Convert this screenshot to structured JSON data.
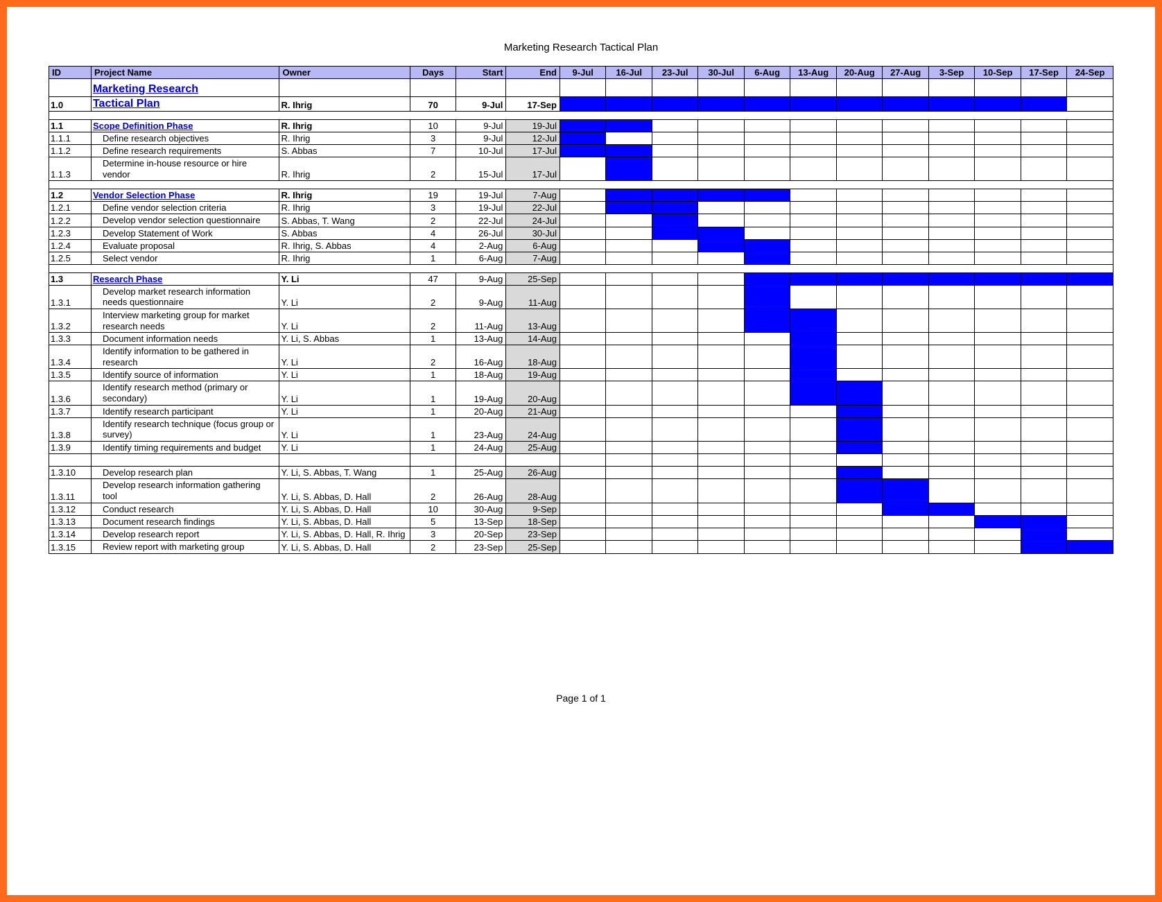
{
  "title": "Marketing Research Tactical Plan",
  "footer": "Page 1 of 1",
  "headers": {
    "id": "ID",
    "name": "Project Name",
    "owner": "Owner",
    "days": "Days",
    "start": "Start",
    "end": "End",
    "weeks": [
      "9-Jul",
      "16-Jul",
      "23-Jul",
      "30-Jul",
      "6-Aug",
      "13-Aug",
      "20-Aug",
      "27-Aug",
      "3-Sep",
      "10-Sep",
      "17-Sep",
      "24-Sep"
    ]
  },
  "rows": [
    {
      "type": "main",
      "id": "",
      "name": "Marketing Research",
      "owner": "",
      "days": "",
      "start": "",
      "end": "",
      "bars": []
    },
    {
      "type": "mainsub",
      "id": "1.0",
      "name": "Tactical Plan",
      "owner": "R. Ihrig",
      "days": "70",
      "start": "9-Jul",
      "end": "17-Sep",
      "bars": [
        0,
        1,
        2,
        3,
        4,
        5,
        6,
        7,
        8,
        9,
        10
      ]
    },
    {
      "type": "spacer"
    },
    {
      "type": "phase",
      "id": "1.1",
      "name": "Scope Definition Phase",
      "owner": "R. Ihrig",
      "days": "10",
      "start": "9-Jul",
      "end": "19-Jul",
      "endshade": true,
      "bars": [
        0,
        1
      ]
    },
    {
      "type": "task",
      "id": "1.1.1",
      "name": "Define research objectives",
      "owner": "R. Ihrig",
      "days": "3",
      "start": "9-Jul",
      "end": "12-Jul",
      "endshade": true,
      "bars": [
        0
      ]
    },
    {
      "type": "task",
      "id": "1.1.2",
      "name": "Define research requirements",
      "owner": "S. Abbas",
      "days": "7",
      "start": "10-Jul",
      "end": "17-Jul",
      "endshade": true,
      "bars": [
        0,
        1
      ]
    },
    {
      "type": "task",
      "id": "1.1.3",
      "name": "Determine in-house resource or hire vendor",
      "owner": "R. Ihrig",
      "days": "2",
      "start": "15-Jul",
      "end": "17-Jul",
      "endshade": true,
      "bars": [
        1
      ],
      "wrap": true
    },
    {
      "type": "spacer"
    },
    {
      "type": "phase",
      "id": "1.2",
      "name": "Vendor Selection Phase",
      "owner": "R. Ihrig",
      "days": "19",
      "start": "19-Jul",
      "end": "7-Aug",
      "endshade": true,
      "bars": [
        1,
        2,
        3,
        4
      ]
    },
    {
      "type": "task",
      "id": "1.2.1",
      "name": "Define vendor selection criteria",
      "owner": "R. Ihrig",
      "days": "3",
      "start": "19-Jul",
      "end": "22-Jul",
      "endshade": true,
      "bars": [
        1,
        2
      ]
    },
    {
      "type": "task",
      "id": "1.2.2",
      "name": "Develop vendor selection questionnaire",
      "owner": "S. Abbas, T. Wang",
      "days": "2",
      "start": "22-Jul",
      "end": "24-Jul",
      "endshade": true,
      "bars": [
        2
      ],
      "wrap": true
    },
    {
      "type": "task",
      "id": "1.2.3",
      "name": "Develop Statement of Work",
      "owner": "S. Abbas",
      "days": "4",
      "start": "26-Jul",
      "end": "30-Jul",
      "endshade": true,
      "bars": [
        2,
        3
      ]
    },
    {
      "type": "task",
      "id": "1.2.4",
      "name": "Evaluate proposal",
      "owner": "R. Ihrig, S. Abbas",
      "days": "4",
      "start": "2-Aug",
      "end": "6-Aug",
      "endshade": true,
      "bars": [
        3,
        4
      ]
    },
    {
      "type": "task",
      "id": "1.2.5",
      "name": "Select vendor",
      "owner": "R. Ihrig",
      "days": "1",
      "start": "6-Aug",
      "end": "7-Aug",
      "endshade": true,
      "bars": [
        4
      ]
    },
    {
      "type": "spacer"
    },
    {
      "type": "phase",
      "id": "1.3",
      "name": "Research Phase",
      "owner": "Y. Li",
      "days": "47",
      "start": "9-Aug",
      "end": "25-Sep",
      "endshade": true,
      "bars": [
        4,
        5,
        6,
        7,
        8,
        9,
        10,
        11
      ]
    },
    {
      "type": "task",
      "id": "1.3.1",
      "name": "Develop market research information needs questionnaire",
      "owner": "Y. Li",
      "days": "2",
      "start": "9-Aug",
      "end": "11-Aug",
      "endshade": true,
      "bars": [
        4
      ],
      "wrap": true
    },
    {
      "type": "task",
      "id": "1.3.2",
      "name": "Interview marketing group for market research needs",
      "owner": "Y. Li",
      "days": "2",
      "start": "11-Aug",
      "end": "13-Aug",
      "endshade": true,
      "bars": [
        4,
        5
      ],
      "wrap": true
    },
    {
      "type": "task",
      "id": "1.3.3",
      "name": "Document information needs",
      "owner": "Y. Li, S. Abbas",
      "days": "1",
      "start": "13-Aug",
      "end": "14-Aug",
      "endshade": true,
      "bars": [
        5
      ]
    },
    {
      "type": "task",
      "id": "1.3.4",
      "name": "Identify information to be gathered in research",
      "owner": "Y. Li",
      "days": "2",
      "start": "16-Aug",
      "end": "18-Aug",
      "endshade": true,
      "bars": [
        5
      ],
      "wrap": true
    },
    {
      "type": "task",
      "id": "1.3.5",
      "name": "Identify source of information",
      "owner": "Y. Li",
      "days": "1",
      "start": "18-Aug",
      "end": "19-Aug",
      "endshade": true,
      "bars": [
        5
      ]
    },
    {
      "type": "task",
      "id": "1.3.6",
      "name": "Identify research method (primary or secondary)",
      "owner": "Y. Li",
      "days": "1",
      "start": "19-Aug",
      "end": "20-Aug",
      "endshade": true,
      "bars": [
        5,
        6
      ],
      "wrap": true
    },
    {
      "type": "task",
      "id": "1.3.7",
      "name": "Identify research participant",
      "owner": "Y. Li",
      "days": "1",
      "start": "20-Aug",
      "end": "21-Aug",
      "endshade": true,
      "bars": [
        6
      ]
    },
    {
      "type": "task",
      "id": "1.3.8",
      "name": "Identify research technique (focus group or survey)",
      "owner": "Y. Li",
      "days": "1",
      "start": "23-Aug",
      "end": "24-Aug",
      "endshade": true,
      "bars": [
        6
      ],
      "wrap": true
    },
    {
      "type": "task",
      "id": "1.3.9",
      "name": "Identify timing requirements and budget",
      "owner": "Y. Li",
      "days": "1",
      "start": "24-Aug",
      "end": "25-Aug",
      "endshade": true,
      "bars": [
        6
      ],
      "wrap": true
    },
    {
      "type": "task",
      "id": "1.3.10",
      "name": "Develop research plan",
      "owner": "Y. Li, S. Abbas, T. Wang",
      "days": "1",
      "start": "25-Aug",
      "end": "26-Aug",
      "endshade": true,
      "bars": [
        6
      ],
      "blankabove": true
    },
    {
      "type": "task",
      "id": "1.3.11",
      "name": "Develop research information gathering tool",
      "owner": "Y. Li, S. Abbas, D. Hall",
      "days": "2",
      "start": "26-Aug",
      "end": "28-Aug",
      "endshade": true,
      "bars": [
        6,
        7
      ],
      "wrap": true
    },
    {
      "type": "task",
      "id": "1.3.12",
      "name": "Conduct research",
      "owner": "Y. Li, S. Abbas, D. Hall",
      "days": "10",
      "start": "30-Aug",
      "end": "9-Sep",
      "endshade": true,
      "bars": [
        7,
        8
      ]
    },
    {
      "type": "task",
      "id": "1.3.13",
      "name": "Document research findings",
      "owner": "Y. Li, S. Abbas, D. Hall",
      "days": "5",
      "start": "13-Sep",
      "end": "18-Sep",
      "endshade": true,
      "bars": [
        9,
        10
      ]
    },
    {
      "type": "task",
      "id": "1.3.14",
      "name": "Develop research report",
      "owner": "Y. Li, S. Abbas, D. Hall, R. Ihrig",
      "days": "3",
      "start": "20-Sep",
      "end": "23-Sep",
      "endshade": true,
      "bars": [
        10
      ],
      "wrapowner": true
    },
    {
      "type": "task",
      "id": "1.3.15",
      "name": "Review report with marketing group",
      "owner": "Y. Li, S. Abbas, D. Hall",
      "days": "2",
      "start": "23-Sep",
      "end": "25-Sep",
      "endshade": true,
      "bars": [
        10,
        11
      ],
      "wrap": true
    }
  ]
}
